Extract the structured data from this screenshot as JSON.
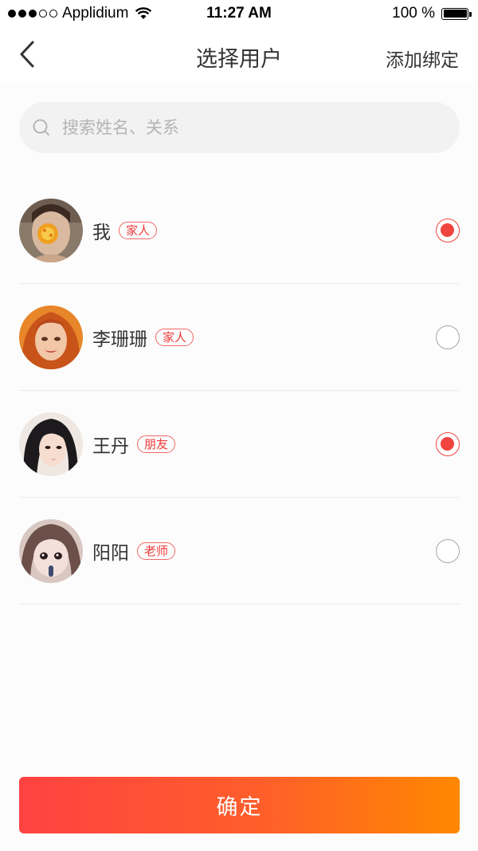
{
  "status_bar": {
    "carrier": "Applidium",
    "time": "11:27 AM",
    "battery": "100 %"
  },
  "nav": {
    "title": "选择用户",
    "action_label": "添加绑定",
    "back_icon": "chevron-left-icon"
  },
  "search": {
    "placeholder": "搜索姓名、关系",
    "value": "",
    "icon": "search-icon"
  },
  "users": [
    {
      "name": "我",
      "relation": "家人",
      "selected": true
    },
    {
      "name": "李珊珊",
      "relation": "家人",
      "selected": false
    },
    {
      "name": "王丹",
      "relation": "朋友",
      "selected": true
    },
    {
      "name": "阳阳",
      "relation": "老师",
      "selected": false
    }
  ],
  "confirm_label": "确定",
  "colors": {
    "accent": "#f0443e",
    "gradient_start": "#ff4242",
    "gradient_end": "#ff8800"
  }
}
